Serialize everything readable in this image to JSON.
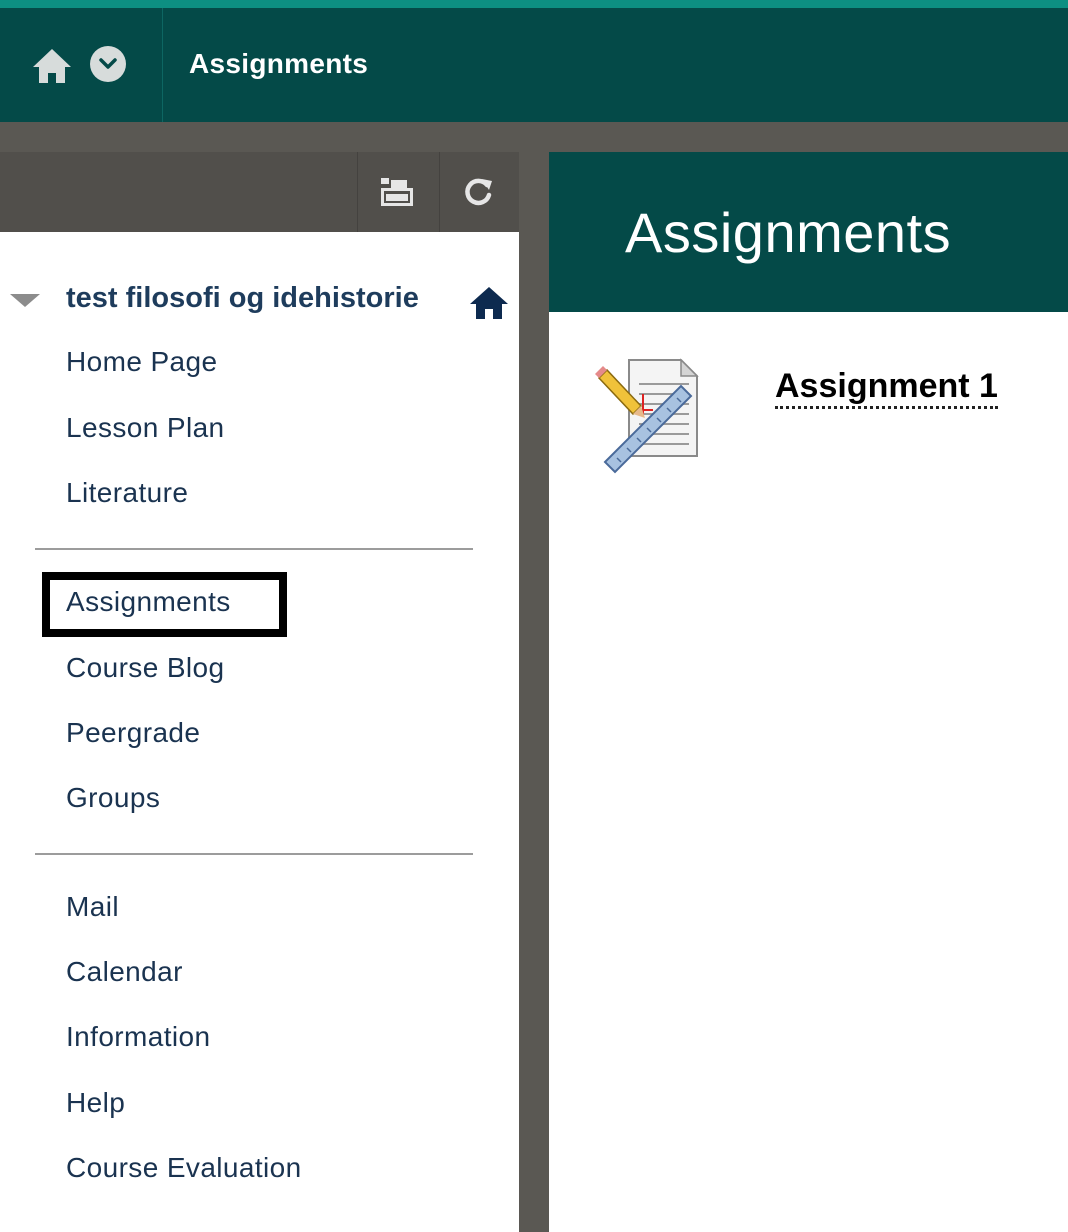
{
  "header": {
    "title": "Assignments"
  },
  "sidebar": {
    "course_title": "test filosofi og idehistorie",
    "groups": [
      {
        "items": [
          {
            "label": "Home Page"
          },
          {
            "label": "Lesson Plan"
          },
          {
            "label": "Literature"
          }
        ]
      },
      {
        "items": [
          {
            "label": "Assignments",
            "selected": true
          },
          {
            "label": "Course Blog"
          },
          {
            "label": "Peergrade"
          },
          {
            "label": "Groups"
          }
        ]
      },
      {
        "items": [
          {
            "label": "Mail"
          },
          {
            "label": "Calendar"
          },
          {
            "label": "Information"
          },
          {
            "label": "Help"
          },
          {
            "label": "Course Evaluation"
          }
        ]
      }
    ],
    "toolbar": {
      "icons": [
        "folder-view-icon",
        "refresh-icon"
      ]
    }
  },
  "content": {
    "title": "Assignments",
    "items": [
      {
        "label": "Assignment 1",
        "icon": "assignment-icon"
      }
    ]
  },
  "colors": {
    "header_bg": "#044a48",
    "accent_strip": "#0d8f82",
    "frame_grey": "#5a5853",
    "nav_text": "#1a3350"
  }
}
